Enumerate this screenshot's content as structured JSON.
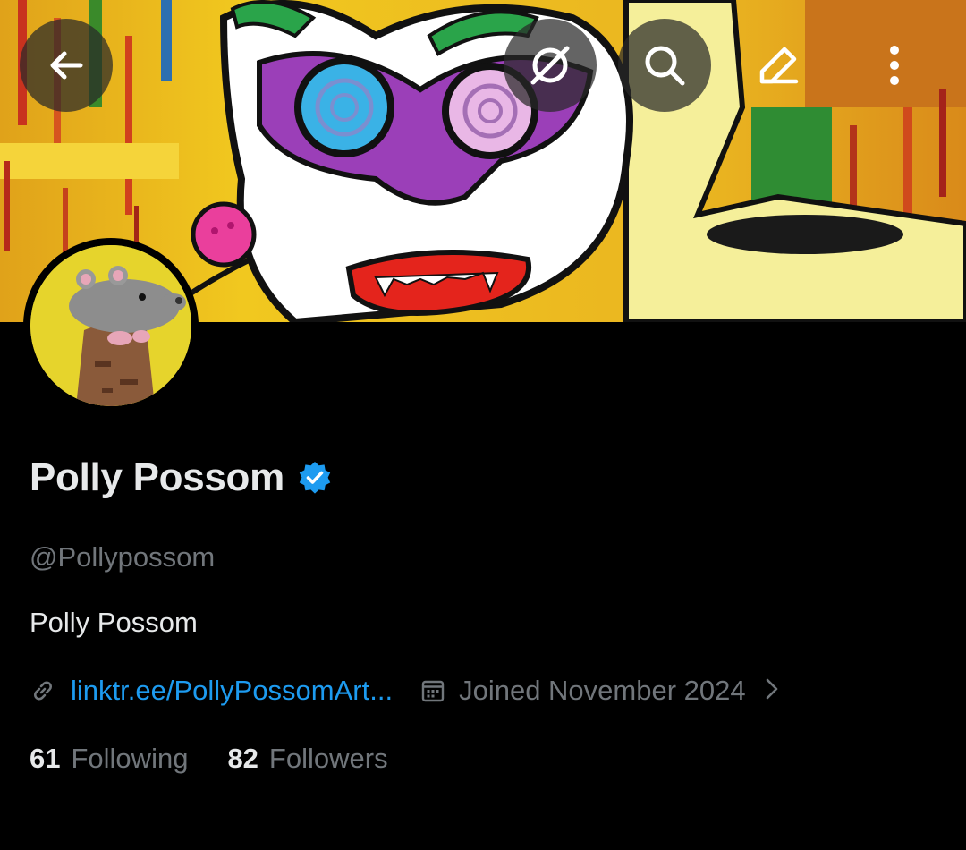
{
  "profile": {
    "display_name": "Polly Possom",
    "handle": "@Pollypossom",
    "bio": "Polly Possom",
    "link": "linktr.ee/PollyPossomArt...",
    "joined": "Joined November 2024",
    "following_count": "61",
    "following_label": "Following",
    "followers_count": "82",
    "followers_label": "Followers"
  },
  "toolbar": {
    "icons": [
      "back-arrow-icon",
      "grok-icon",
      "search-icon",
      "edit-icon",
      "more-vertical-icon"
    ]
  },
  "colors": {
    "background": "#000000",
    "text_primary": "#e7e9ea",
    "text_secondary": "#71767b",
    "link": "#1d9bf0",
    "verified_badge": "#1d9bf0"
  }
}
